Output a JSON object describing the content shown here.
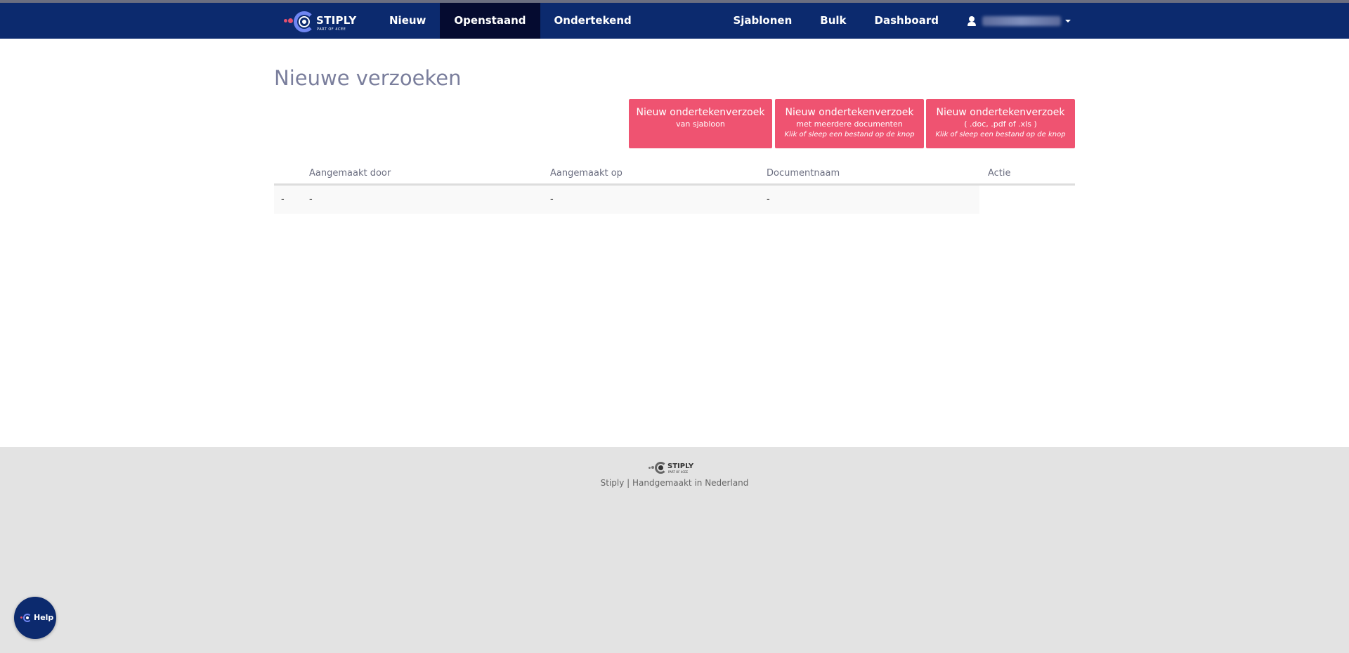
{
  "brand": {
    "name": "STIPLY",
    "tagline": "PART OF 4CEE"
  },
  "nav": {
    "left": [
      {
        "label": "Nieuw",
        "active": false
      },
      {
        "label": "Openstaand",
        "active": true
      },
      {
        "label": "Ondertekend",
        "active": false
      }
    ],
    "right": [
      {
        "label": "Sjablonen"
      },
      {
        "label": "Bulk"
      },
      {
        "label": "Dashboard"
      }
    ]
  },
  "page": {
    "title": "Nieuwe verzoeken"
  },
  "buttons": [
    {
      "line1": "Nieuw ondertekenverzoek",
      "line2": "van sjabloon",
      "line3": ""
    },
    {
      "line1": "Nieuw ondertekenverzoek",
      "line2": "met meerdere documenten",
      "line3": "Klik of sleep een bestand op de knop"
    },
    {
      "line1": "Nieuw ondertekenverzoek",
      "line2": "( .doc, .pdf of .xls )",
      "line3": "Klik of sleep een bestand op de knop"
    }
  ],
  "table": {
    "columns": [
      "Aangemaakt door",
      "Aangemaakt op",
      "Documentnaam",
      "Actie"
    ],
    "rows": [
      {
        "marker": "-",
        "created_by": "-",
        "created_on": "-",
        "document": "-"
      }
    ]
  },
  "footer": {
    "logo_name": "STIPLY",
    "logo_tagline": "PART OF 4CEE",
    "text": "Stiply | Handgemaakt in Nederland"
  },
  "help": {
    "label": "Help"
  },
  "colors": {
    "navbar": "#0c2a6e",
    "nav_active": "#050b30",
    "accent": "#ef5371",
    "footer": "#e3e3e3"
  }
}
